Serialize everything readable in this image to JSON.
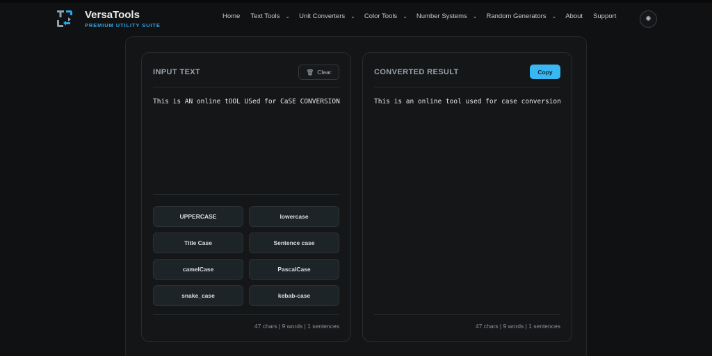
{
  "brand": {
    "name": "VersaTools",
    "tagline": "PREMIUM UTILITY SUITE",
    "accent": "#2ea6e8"
  },
  "nav": [
    {
      "label": "Home",
      "dropdown": false
    },
    {
      "label": "Text Tools",
      "dropdown": true
    },
    {
      "label": "Unit Converters",
      "dropdown": true
    },
    {
      "label": "Color Tools",
      "dropdown": true
    },
    {
      "label": "Number Systems",
      "dropdown": true
    },
    {
      "label": "Random Generators",
      "dropdown": true
    },
    {
      "label": "About",
      "dropdown": false
    },
    {
      "label": "Support",
      "dropdown": false
    }
  ],
  "theme_toggle": {
    "icon": "sun-icon"
  },
  "input_panel": {
    "title": "INPUT TEXT",
    "clear_label": "Clear",
    "text": "This is AN online tOOL USed for CaSE CONVERSION",
    "stats": "47 chars | 9 words | 1 sentences"
  },
  "output_panel": {
    "title": "CONVERTED RESULT",
    "copy_label": "Copy",
    "text": "This is an online tool used for case conversion",
    "stats": "47 chars | 9 words | 1 sentences",
    "copy_color": "#39b7f3"
  },
  "case_buttons": [
    "UPPERCASE",
    "lowercase",
    "Title Case",
    "Sentence case",
    "camelCase",
    "PascalCase",
    "snake_case",
    "kebab-case"
  ]
}
